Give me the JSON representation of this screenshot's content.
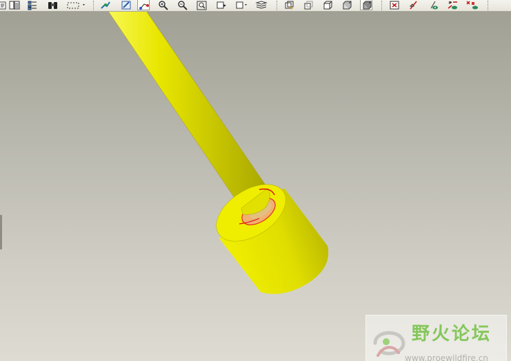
{
  "toolbar": {
    "groups": [
      {
        "name": "file-tools",
        "items": [
          {
            "icon": "text-frame-icon"
          },
          {
            "icon": "clipboard-list-icon"
          },
          {
            "icon": "tree-hierarchy-icon"
          },
          {
            "icon": "binoculars-icon"
          },
          {
            "icon": "selection-box-icon"
          }
        ]
      },
      {
        "name": "view-tools",
        "items": [
          {
            "icon": "spin-center-icon"
          },
          {
            "icon": "repaint-icon"
          },
          {
            "icon": "orient-mode-icon",
            "pressed": true
          },
          {
            "icon": "zoom-in-icon"
          },
          {
            "icon": "zoom-out-icon"
          },
          {
            "icon": "zoom-fit-icon"
          },
          {
            "icon": "reorient-icon"
          },
          {
            "icon": "saved-views-icon"
          },
          {
            "icon": "layers-icon"
          }
        ]
      },
      {
        "name": "display-style",
        "items": [
          {
            "icon": "wireframe-icon"
          },
          {
            "icon": "hidden-line-icon"
          },
          {
            "icon": "no-hidden-icon"
          },
          {
            "icon": "shaded-icon"
          },
          {
            "icon": "enhanced-realism-icon",
            "pressed": true
          }
        ]
      },
      {
        "name": "datum-display",
        "items": [
          {
            "icon": "datum-planes-icon"
          },
          {
            "icon": "datum-axes-icon"
          },
          {
            "icon": "datum-points-icon"
          },
          {
            "icon": "coordinate-systems-icon"
          },
          {
            "icon": "annotations-icon"
          }
        ]
      }
    ]
  },
  "colors": {
    "part": "#e2e000",
    "part_dark": "#a4a200",
    "contact_face": "#f0b070",
    "edge_highlight": "#e01010",
    "watermark_green": "#84c75a"
  },
  "watermark": {
    "title": "野火论坛",
    "url": "www.proewildfire.cn",
    "logo_icon": "proe-logo-icon"
  }
}
